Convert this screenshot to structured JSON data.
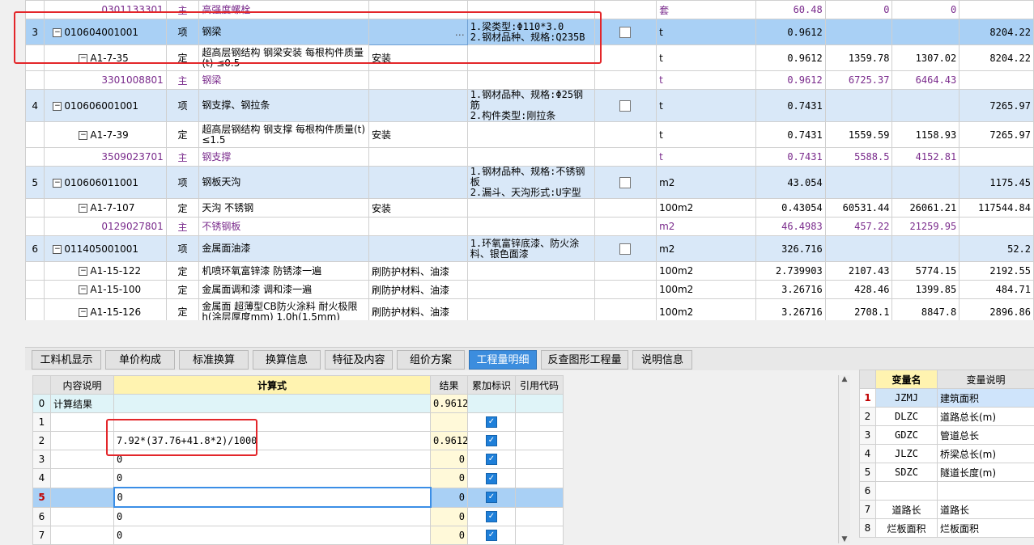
{
  "top_rows": [
    {
      "kind": "child",
      "num": "",
      "code": "0301133301",
      "type": "主",
      "name": "高强度螺栓",
      "feature": "",
      "spec": "",
      "check": false,
      "unit": "套",
      "qty": "60.48",
      "p1": "0",
      "p2": "0",
      "total": ""
    },
    {
      "kind": "selected",
      "num": "3",
      "code": "010604001001",
      "type": "项",
      "name": "钢梁",
      "feature": "…",
      "spec": "1.梁类型:Φ110*3.0\n2.钢材品种、规格:Q235B",
      "check": true,
      "unit": "t",
      "qty": "0.9612",
      "p1": "",
      "p2": "",
      "total": "8204.22"
    },
    {
      "kind": "norm",
      "num": "",
      "code": "A1-7-35",
      "type": "定",
      "name": "超高层钢结构 钢梁安装 每根构件质量(t) ≤0.5",
      "feature": "安装",
      "spec": "",
      "check": false,
      "unit": "t",
      "qty": "0.9612",
      "p1": "1359.78",
      "p2": "1307.02",
      "total": "8204.22"
    },
    {
      "kind": "child",
      "num": "",
      "code": "3301008801",
      "type": "主",
      "name": "钢梁",
      "feature": "",
      "spec": "",
      "check": false,
      "unit": "t",
      "qty": "0.9612",
      "p1": "6725.37",
      "p2": "6464.43",
      "total": ""
    },
    {
      "kind": "header",
      "num": "4",
      "code": "010606001001",
      "type": "项",
      "name": "钢支撑、钢拉条",
      "feature": "",
      "spec": "1.钢材品种、规格:Φ25钢筋\n2.构件类型:刚拉条",
      "check": true,
      "unit": "t",
      "qty": "0.7431",
      "p1": "",
      "p2": "",
      "total": "7265.97"
    },
    {
      "kind": "norm",
      "num": "",
      "code": "A1-7-39",
      "type": "定",
      "name": "超高层钢结构 钢支撑 每根构件质量(t) ≤1.5",
      "feature": "安装",
      "spec": "",
      "check": false,
      "unit": "t",
      "qty": "0.7431",
      "p1": "1559.59",
      "p2": "1158.93",
      "total": "7265.97"
    },
    {
      "kind": "child",
      "num": "",
      "code": "3509023701",
      "type": "主",
      "name": "钢支撑",
      "feature": "",
      "spec": "",
      "check": false,
      "unit": "t",
      "qty": "0.7431",
      "p1": "5588.5",
      "p2": "4152.81",
      "total": ""
    },
    {
      "kind": "header",
      "num": "5",
      "code": "010606011001",
      "type": "项",
      "name": "钢板天沟",
      "feature": "",
      "spec": "1.钢材品种、规格:不锈钢板\n2.漏斗、天沟形式:U字型",
      "check": true,
      "unit": "m2",
      "qty": "43.054",
      "p1": "",
      "p2": "",
      "total": "1175.45"
    },
    {
      "kind": "norm",
      "num": "",
      "code": "A1-7-107",
      "type": "定",
      "name": "天沟 不锈钢",
      "feature": "安装",
      "spec": "",
      "check": false,
      "unit": "100m2",
      "qty": "0.43054",
      "p1": "60531.44",
      "p2": "26061.21",
      "total": "117544.84"
    },
    {
      "kind": "child",
      "num": "",
      "code": "0129027801",
      "type": "主",
      "name": "不锈钢板",
      "feature": "",
      "spec": "",
      "check": false,
      "unit": "m2",
      "qty": "46.4983",
      "p1": "457.22",
      "p2": "21259.95",
      "total": ""
    },
    {
      "kind": "header",
      "num": "6",
      "code": "011405001001",
      "type": "项",
      "name": "金属面油漆",
      "feature": "",
      "spec": "1.环氧富锌底漆、防火涂料、银色面漆",
      "check": true,
      "unit": "m2",
      "qty": "326.716",
      "p1": "",
      "p2": "",
      "total": "52.2"
    },
    {
      "kind": "norm",
      "num": "",
      "code": "A1-15-122",
      "type": "定",
      "name": "机喷环氧富锌漆 防锈漆一遍",
      "feature": "刷防护材料、油漆",
      "spec": "",
      "check": false,
      "unit": "100m2",
      "qty": "2.739903",
      "p1": "2107.43",
      "p2": "5774.15",
      "total": "2192.55"
    },
    {
      "kind": "norm",
      "num": "",
      "code": "A1-15-100",
      "type": "定",
      "name": "金属面调和漆 调和漆一遍",
      "feature": "刷防护材料、油漆",
      "spec": "",
      "check": false,
      "unit": "100m2",
      "qty": "3.26716",
      "p1": "428.46",
      "p2": "1399.85",
      "total": "484.71"
    },
    {
      "kind": "norm",
      "num": "",
      "code": "A1-15-126",
      "type": "定",
      "name": "金属面 超薄型CB防火涂料 耐火极限h(涂层厚度mm) 1.0h(1.5mm)",
      "feature": "刷防护材料、油漆",
      "spec": "",
      "check": false,
      "unit": "100m2",
      "qty": "3.26716",
      "p1": "2708.1",
      "p2": "8847.8",
      "total": "2896.86"
    }
  ],
  "tabs": [
    "工料机显示",
    "单价构成",
    "标准换算",
    "换算信息",
    "特征及内容",
    "组价方案",
    "工程量明细",
    "反查图形工程量",
    "说明信息"
  ],
  "active_tab": "工程量明细",
  "calc_table": {
    "headers": {
      "desc": "内容说明",
      "formula": "计算式",
      "result": "结果",
      "accum": "累加标识",
      "ref": "引用代码"
    },
    "rows": [
      {
        "idx": "0",
        "desc": "计算结果",
        "formula": "",
        "result": "0.9612",
        "checked": false
      },
      {
        "idx": "1",
        "desc": "",
        "formula": "",
        "result": "",
        "checked": true
      },
      {
        "idx": "2",
        "desc": "",
        "formula": "7.92*(37.76+41.8*2)/1000",
        "result": "0.9612",
        "checked": true
      },
      {
        "idx": "3",
        "desc": "",
        "formula": "0",
        "result": "0",
        "checked": true
      },
      {
        "idx": "4",
        "desc": "",
        "formula": "0",
        "result": "0",
        "checked": true
      },
      {
        "idx": "5",
        "desc": "",
        "formula": "0",
        "result": "0",
        "checked": true
      },
      {
        "idx": "6",
        "desc": "",
        "formula": "0",
        "result": "0",
        "checked": true
      },
      {
        "idx": "7",
        "desc": "",
        "formula": "0",
        "result": "0",
        "checked": true
      }
    ]
  },
  "var_table": {
    "headers": {
      "name": "变量名",
      "desc": "变量说明"
    },
    "rows": [
      {
        "idx": "1",
        "code": "JZMJ",
        "desc": "建筑面积"
      },
      {
        "idx": "2",
        "code": "DLZC",
        "desc": "道路总长(m)"
      },
      {
        "idx": "3",
        "code": "GDZC",
        "desc": "管道总长"
      },
      {
        "idx": "4",
        "code": "JLZC",
        "desc": "桥梁总长(m)"
      },
      {
        "idx": "5",
        "code": "SDZC",
        "desc": "隧道长度(m)"
      },
      {
        "idx": "6",
        "code": "",
        "desc": ""
      },
      {
        "idx": "7",
        "code": "道路长",
        "desc": "道路长"
      },
      {
        "idx": "8",
        "code": "烂板面积",
        "desc": "烂板面积"
      }
    ]
  },
  "scroll": {
    "up": "▲",
    "down": "▼"
  }
}
